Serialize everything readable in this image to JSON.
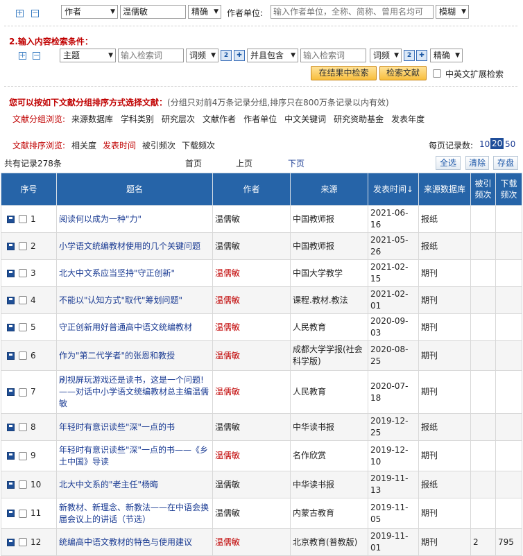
{
  "author_row": {
    "field_select": "作者",
    "author_value": "温儒敏",
    "match_select": "精确",
    "unit_label": "作者单位:",
    "unit_placeholder": "输入作者单位，全称、简称、曾用名均可",
    "unit_match_select": "模糊"
  },
  "content_section": {
    "heading": "2.输入内容检索条件：",
    "field1_select": "主题",
    "keyword1_placeholder": "输入检索词",
    "freq1_select": "词频",
    "logic_select": "并且包含",
    "keyword2_placeholder": "输入检索词",
    "freq2_select": "词频",
    "match_select": "精确",
    "search_in_results_button": "在结果中检索",
    "search_button": "检索文献",
    "extend_checkbox_label": "中英文扩展检索"
  },
  "grouping": {
    "intro_red": "您可以按如下文献分组排序方式选择文献：",
    "intro_note": "(分组只对前4万条记录分组,排序只在800万条记录以内有效)",
    "browse_label": "文献分组浏览:",
    "browse_items": [
      "来源数据库",
      "学科类别",
      "研究层次",
      "文献作者",
      "作者单位",
      "中文关键词",
      "研究资助基金",
      "发表年度"
    ],
    "sort_label": "文献排序浏览:",
    "sort_items": [
      "相关度",
      "发表时间",
      "被引频次",
      "下载频次"
    ],
    "page_size_label": "每页记录数:",
    "page_sizes": [
      "10",
      "20",
      "50"
    ]
  },
  "pager": {
    "total": "共有记录278条",
    "first": "首页",
    "prev": "上页",
    "next": "下页",
    "select_all": "全选",
    "clear": "清除",
    "save": "存盘"
  },
  "table": {
    "headers": [
      "序号",
      "题名",
      "作者",
      "来源",
      "发表时间↓",
      "来源数据库",
      "被引频次",
      "下载频次"
    ],
    "rows": [
      {
        "num": "1",
        "title": "阅读何以成为一种\"力\"",
        "author": "温儒敏",
        "source": "中国教师报",
        "date": "2021-06-16",
        "db": "报纸",
        "cited": "",
        "downloads": ""
      },
      {
        "num": "2",
        "title": "小学语文统编教材使用的几个关键问题",
        "author": "温儒敏",
        "source": "中国教师报",
        "date": "2021-05-26",
        "db": "报纸",
        "cited": "",
        "downloads": ""
      },
      {
        "num": "3",
        "title": "北大中文系应当坚持\"守正创新\"",
        "author": "温儒敏",
        "source": "中国大学教学",
        "date": "2021-02-15",
        "db": "期刊",
        "cited": "",
        "downloads": ""
      },
      {
        "num": "4",
        "title": "不能以\"认知方式\"取代\"筹划问题\"",
        "author": "温儒敏",
        "source": "课程.教材.教法",
        "date": "2021-02-01",
        "db": "期刊",
        "cited": "",
        "downloads": ""
      },
      {
        "num": "5",
        "title": "守正创新用好普通高中语文统编教材",
        "author": "温儒敏",
        "source": "人民教育",
        "date": "2020-09-03",
        "db": "期刊",
        "cited": "",
        "downloads": ""
      },
      {
        "num": "6",
        "title": "作为\"第二代学者\"的张恩和教授",
        "author": "温儒敏",
        "source": "成都大学学报(社会科学版)",
        "date": "2020-08-25",
        "db": "期刊",
        "cited": "",
        "downloads": ""
      },
      {
        "num": "7",
        "title": "刷视屏玩游戏还是读书，这是一个问题!——对话中小学语文统编教材总主编温儒敏",
        "author": "温儒敏",
        "source": "人民教育",
        "date": "2020-07-18",
        "db": "期刊",
        "cited": "",
        "downloads": ""
      },
      {
        "num": "8",
        "title": "年轻时有意识读些\"深\"一点的书",
        "author": "温儒敏",
        "source": "中华读书报",
        "date": "2019-12-25",
        "db": "报纸",
        "cited": "",
        "downloads": ""
      },
      {
        "num": "9",
        "title": "年轻时有意识读些\"深\"一点的书——《乡土中国》导读",
        "author": "温儒敏",
        "source": "名作欣赏",
        "date": "2019-12-10",
        "db": "期刊",
        "cited": "",
        "downloads": ""
      },
      {
        "num": "10",
        "title": "北大中文系的\"老主任\"杨晦",
        "author": "温儒敏",
        "source": "中华读书报",
        "date": "2019-11-13",
        "db": "报纸",
        "cited": "",
        "downloads": ""
      },
      {
        "num": "11",
        "title": "新教材、新理念、新教法——在中语会换届会议上的讲话（节选）",
        "author": "温儒敏",
        "source": "内蒙古教育",
        "date": "2019-11-05",
        "db": "期刊",
        "cited": "",
        "downloads": ""
      },
      {
        "num": "12",
        "title": "统编高中语文教材的特色与使用建议",
        "author": "温儒敏",
        "source": "北京教育(普教版)",
        "date": "2019-11-01",
        "db": "期刊",
        "cited": "2",
        "downloads": "795"
      }
    ]
  }
}
